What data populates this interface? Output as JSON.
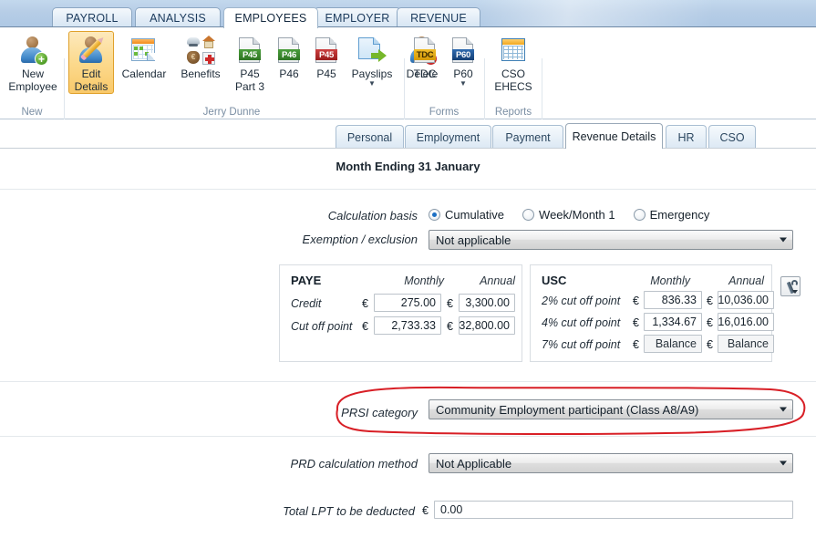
{
  "ribbon_tabs": [
    {
      "label": "PAYROLL",
      "active": false
    },
    {
      "label": "ANALYSIS",
      "active": false
    },
    {
      "label": "EMPLOYEES",
      "active": true
    },
    {
      "label": "EMPLOYER",
      "active": false
    },
    {
      "label": "REVENUE",
      "active": false
    }
  ],
  "ribbon": {
    "groups": [
      {
        "title": "New"
      },
      {
        "title": "Jerry Dunne"
      },
      {
        "title": "Forms"
      },
      {
        "title": "Reports"
      }
    ],
    "buttons": [
      {
        "label": "New\nEmployee",
        "line1": "New",
        "line2": "Employee",
        "icon": "new-employee-icon",
        "selected": false,
        "dropdown": false
      },
      {
        "label": "Edit Details",
        "line1": "Edit",
        "line2": "Details",
        "icon": "edit-details-icon",
        "selected": true,
        "dropdown": false
      },
      {
        "label": "Calendar",
        "line1": "Calendar",
        "line2": "",
        "icon": "calendar-icon",
        "selected": false,
        "dropdown": false
      },
      {
        "label": "Benefits",
        "line1": "Benefits",
        "line2": "",
        "icon": "benefits-icon",
        "selected": false,
        "dropdown": false
      },
      {
        "label": "P45 Part 3",
        "line1": "P45",
        "line2": "Part 3",
        "icon": "p45-part3-icon",
        "tag": "P45",
        "selected": false,
        "dropdown": false
      },
      {
        "label": "P46",
        "line1": "P46",
        "line2": "",
        "icon": "p46-icon",
        "tag": "P46",
        "selected": false,
        "dropdown": false
      },
      {
        "label": "P45",
        "line1": "P45",
        "line2": "",
        "icon": "p45-icon",
        "tag": "P45",
        "selected": false,
        "dropdown": false
      },
      {
        "label": "Payslips",
        "line1": "Payslips",
        "line2": "",
        "icon": "payslips-icon",
        "selected": false,
        "dropdown": true
      },
      {
        "label": "Delete",
        "line1": "Delete",
        "line2": "",
        "icon": "delete-employee-icon",
        "selected": false,
        "dropdown": false
      },
      {
        "label": "TDC",
        "line1": "TDC",
        "line2": "",
        "icon": "tdc-icon",
        "tag": "TDC",
        "selected": false,
        "dropdown": false
      },
      {
        "label": "P60",
        "line1": "P60",
        "line2": "",
        "icon": "p60-icon",
        "tag": "P60",
        "selected": false,
        "dropdown": true
      },
      {
        "label": "CSO EHECS",
        "line1": "CSO",
        "line2": "EHECS",
        "icon": "cso-ehecs-icon",
        "selected": false,
        "dropdown": false
      }
    ]
  },
  "page_tabs": [
    {
      "label": "Personal",
      "active": false
    },
    {
      "label": "Employment",
      "active": false
    },
    {
      "label": "Payment",
      "active": false
    },
    {
      "label": "Revenue Details",
      "active": true
    },
    {
      "label": "HR",
      "active": false
    },
    {
      "label": "CSO",
      "active": false
    }
  ],
  "form": {
    "month_title": "Month Ending 31 January",
    "calculation_basis": {
      "label": "Calculation basis",
      "options": [
        {
          "label": "Cumulative",
          "selected": true
        },
        {
          "label": "Week/Month 1",
          "selected": false
        },
        {
          "label": "Emergency",
          "selected": false
        }
      ]
    },
    "exemption": {
      "label": "Exemption / exclusion",
      "value": "Not applicable"
    },
    "paye": {
      "title": "PAYE",
      "col_monthly": "Monthly",
      "col_annual": "Annual",
      "currency": "€",
      "rows": [
        {
          "label": "Credit",
          "monthly": "275.00",
          "annual": "3,300.00",
          "readonly": false
        },
        {
          "label": "Cut off point",
          "monthly": "2,733.33",
          "annual": "32,800.00",
          "readonly": false
        }
      ]
    },
    "usc": {
      "title": "USC",
      "col_monthly": "Monthly",
      "col_annual": "Annual",
      "currency": "€",
      "rows": [
        {
          "label": "2% cut off point",
          "monthly": "836.33",
          "annual": "10,036.00",
          "readonly": false
        },
        {
          "label": "4% cut off point",
          "monthly": "1,334.67",
          "annual": "16,016.00",
          "readonly": false
        },
        {
          "label": "7% cut off point",
          "monthly": "Balance",
          "annual": "Balance",
          "readonly": true
        }
      ]
    },
    "usc_tool_button": "usc-settings",
    "prsi": {
      "label": "PRSI category",
      "value": "Community Employment participant (Class A8/A9)",
      "highlighted": true
    },
    "prd": {
      "label": "PRD calculation method",
      "value": "Not Applicable"
    },
    "lpt": {
      "label": "Total LPT to be deducted",
      "currency": "€",
      "value": "0.00"
    }
  },
  "colors": {
    "annotation": "#d81f26",
    "selected_ribbon_button": "#f9c96a",
    "tabstrip": "#b6cde6",
    "accent_radio": "#1b6fc4"
  }
}
